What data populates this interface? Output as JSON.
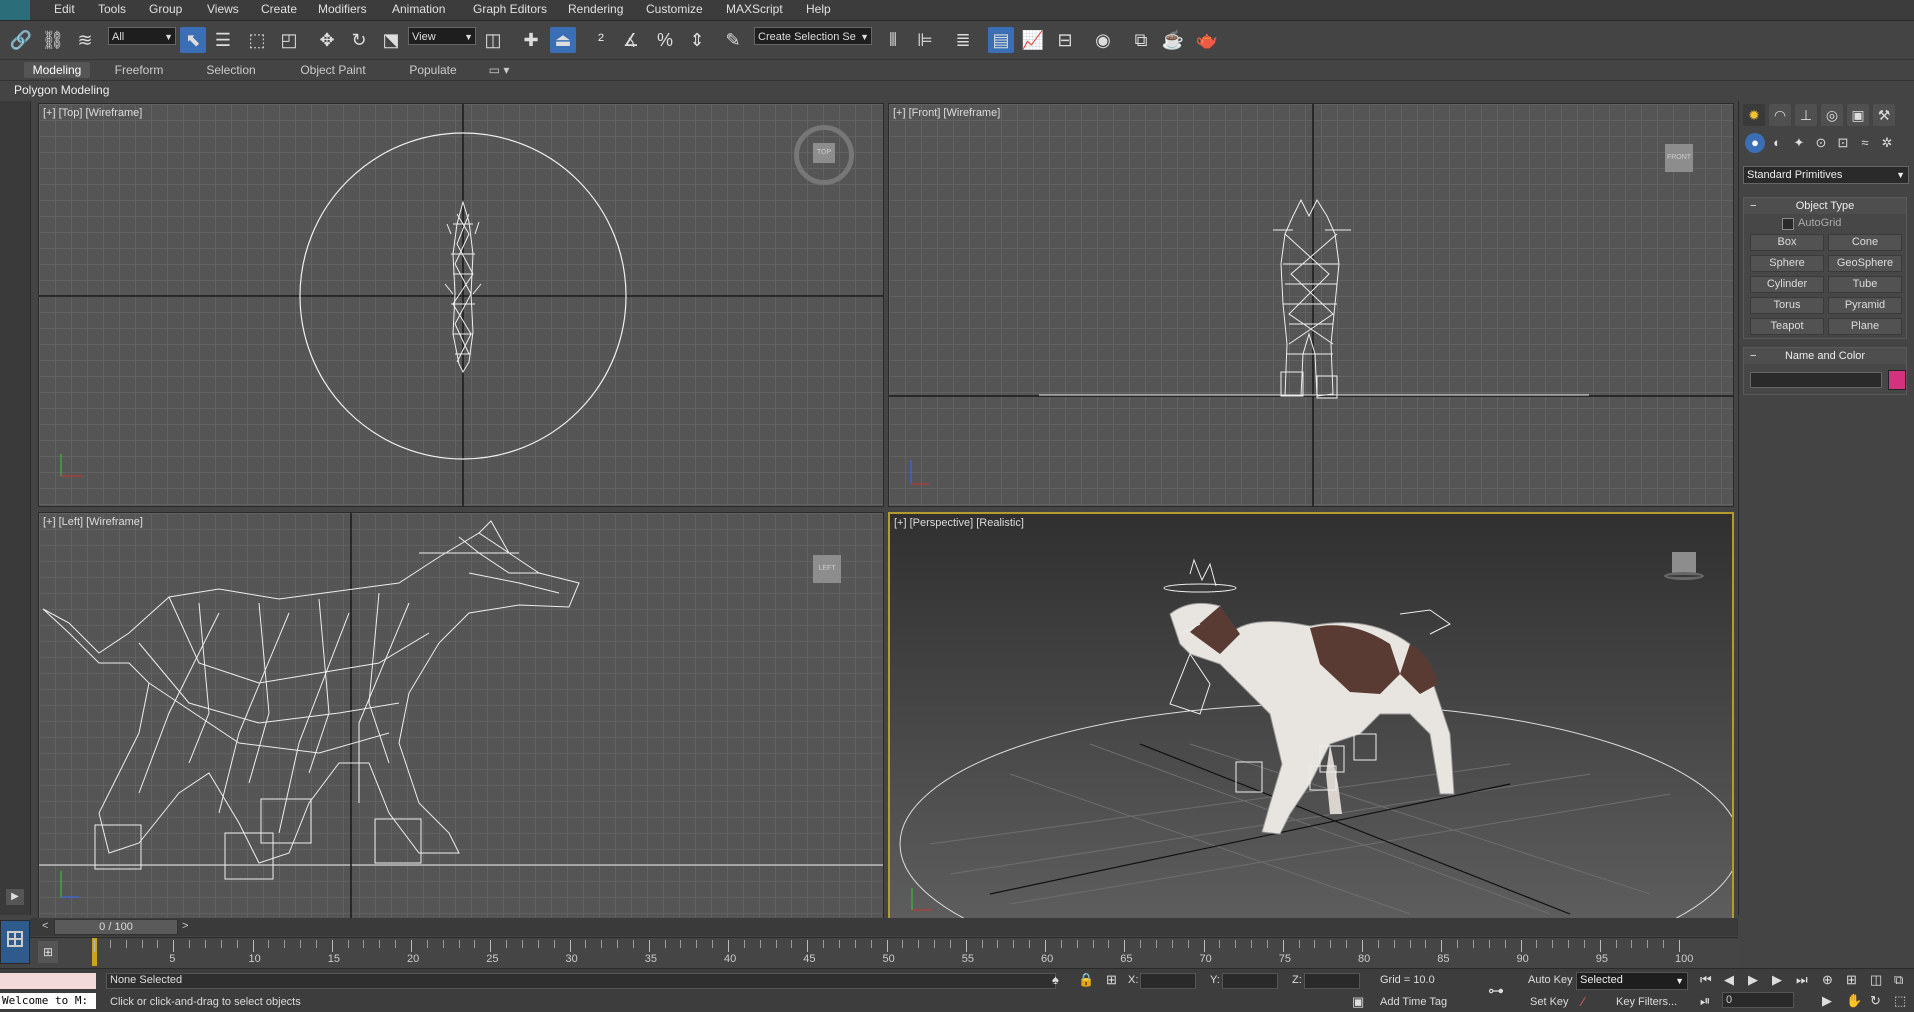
{
  "menu": [
    "Edit",
    "Tools",
    "Group",
    "Views",
    "Create",
    "Modifiers",
    "Animation",
    "Graph Editors",
    "Rendering",
    "Customize",
    "MAXScript",
    "Help"
  ],
  "toolbar": {
    "selection_filter": "All",
    "ref_coord": "View",
    "named_selection_placeholder": "Create Selection Se",
    "icons": [
      "link-icon",
      "unlink-icon",
      "bind-spacewarp-icon",
      "select-object-icon",
      "select-by-name-icon",
      "rect-region-icon",
      "window-crossing-icon",
      "move-icon",
      "rotate-icon",
      "scale-icon",
      "pivot-icon",
      "select-manipulate-icon",
      "keyboard-shortcut-icon",
      "snap-toggle-icon",
      "angle-snap-icon",
      "percent-snap-icon",
      "spinner-snap-icon",
      "edit-named-sel-icon",
      "mirror-icon",
      "align-icon",
      "layer-manager-icon",
      "scene-explorer-icon",
      "curve-editor-icon",
      "schematic-view-icon",
      "material-editor-icon",
      "render-setup-icon",
      "rendered-frame-icon",
      "render-icon"
    ]
  },
  "ribbon": {
    "tabs": [
      "Modeling",
      "Freeform",
      "Selection",
      "Object Paint",
      "Populate"
    ],
    "active_tab": "Modeling",
    "sub_label": "Polygon Modeling"
  },
  "viewports": {
    "top": {
      "label": "[+] [Top] [Wireframe]",
      "navcube": "TOP"
    },
    "front": {
      "label": "[+] [Front] [Wireframe]",
      "navcube": "FRONT"
    },
    "left": {
      "label": "[+] [Left] [Wireframe]",
      "navcube": "LEFT"
    },
    "perspective": {
      "label": "[+] [Perspective] [Realistic]"
    }
  },
  "command_panel": {
    "category_dropdown": "Standard Primitives",
    "object_type_title": "Object Type",
    "autogrid_label": "AutoGrid",
    "primitives": [
      "Box",
      "Cone",
      "Sphere",
      "GeoSphere",
      "Cylinder",
      "Tube",
      "Torus",
      "Pyramid",
      "Teapot",
      "Plane"
    ],
    "name_color_title": "Name and Color",
    "name_value": "",
    "object_color": "#d4327f"
  },
  "timeline": {
    "frame_display": "0 / 100",
    "tick_labels": [
      "5",
      "10",
      "15",
      "20",
      "25",
      "30",
      "35",
      "40",
      "45",
      "50",
      "55",
      "60",
      "65",
      "70",
      "75",
      "80",
      "85",
      "90",
      "95",
      "100"
    ]
  },
  "status": {
    "maxscript_listener": "Welcome to M:",
    "selection_status": "None Selected",
    "prompt": "Click or click-and-drag to select objects",
    "x_label": "X:",
    "y_label": "Y:",
    "z_label": "Z:",
    "x_value": "",
    "y_value": "",
    "z_value": "",
    "grid": "Grid = 10.0",
    "add_time_tag": "Add Time Tag",
    "auto_key": "Auto Key",
    "set_key": "Set Key",
    "key_mode": "Selected",
    "key_filters": "Key Filters...",
    "current_frame": "0"
  }
}
